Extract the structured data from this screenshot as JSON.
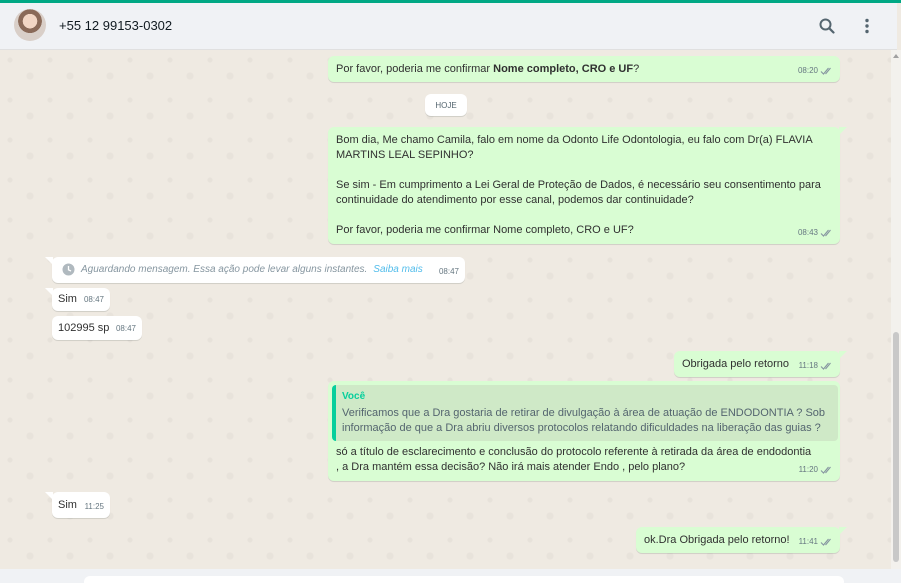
{
  "header": {
    "contact_name": "+55 12 99153-0302",
    "icons": [
      "search-icon",
      "menu-dots-icon"
    ]
  },
  "colors": {
    "accent": "#00a884",
    "outgoing_bubble": "#d9fdd3",
    "incoming_bubble": "#ffffff",
    "chat_background": "#efeae2",
    "quote_author": "#06cf9c"
  },
  "chat": {
    "day_label": "HOJE",
    "msg1": {
      "pre": "Por favor, poderia me confirmar ",
      "bold": "Nome completo, CRO e UF",
      "post": "?",
      "time": "08:20"
    },
    "msg2": {
      "text": "Bom dia, Me chamo Camila, falo em nome da Odonto Life Odontologia, eu falo com Dr(a) FLAVIA\nMARTINS LEAL SEPINHO?\n\nSe sim - Em cumprimento a Lei Geral de Proteção de Dados, é necessário seu consentimento para\ncontinuidade do atendimento por esse canal, podemos dar continuidade?\n\nPor favor, poderia me confirmar Nome completo, CRO e UF?",
      "time": "08:43"
    },
    "waiting": {
      "text": "Aguardando mensagem. Essa ação pode levar alguns instantes.",
      "link": "Saiba mais",
      "time": "08:47"
    },
    "msg_sim1": {
      "text": "Sim",
      "time": "08:47"
    },
    "msg_cro": {
      "text": "102995 sp",
      "time": "08:47"
    },
    "msg_obrigada": {
      "text": "Obrigada pelo retorno",
      "time": "11:18"
    },
    "msg_reply": {
      "quote_author": "Você",
      "quote_text": "Verificamos que a Dra gostaria de retirar de divulgação à área de atuação de ENDODONTIA ? Sob informação de que a Dra abriu diversos protocolos relatando dificuldades na liberação das guias ?",
      "text": "só a título de esclarecimento e conclusão do protocolo referente à retirada da área de endodontia\n, a Dra mantém essa decisão? Não irá mais atender Endo , pelo plano?",
      "time": "11:20"
    },
    "msg_sim2": {
      "text": "Sim",
      "time": "11:25"
    },
    "msg_final": {
      "text": "ok.Dra Obrigada pelo retorno!",
      "time": "11:41"
    }
  }
}
